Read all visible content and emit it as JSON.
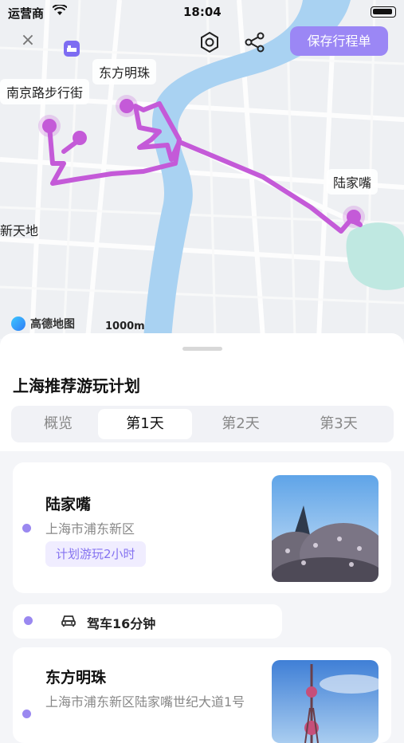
{
  "status_bar": {
    "carrier": "运营商",
    "time": "18:04"
  },
  "header": {
    "save_label": "保存行程单",
    "icons": [
      "close-icon",
      "hotel-icon",
      "settings-icon",
      "share-icon"
    ]
  },
  "map": {
    "labels": {
      "nanjing_road": "南京路步行街",
      "oriental_pearl": "东方明珠",
      "lujiazui": "陆家嘴",
      "xintiandi": "新天地"
    },
    "provider": "高德地图",
    "scale": "1000m",
    "route_color": "#c45ad8",
    "water_color": "#a9d2f2",
    "park_color": "#bfe8e1"
  },
  "plan": {
    "title": "上海推荐游玩计划",
    "tabs": [
      "概览",
      "第1天",
      "第2天",
      "第3天"
    ],
    "active_tab": 1
  },
  "itinerary": {
    "spots": [
      {
        "name": "陆家嘴",
        "address": "上海市浦东新区",
        "duration": "计划游玩2小时"
      },
      {
        "name": "东方明珠",
        "address": "上海市浦东新区陆家嘴世纪大道1号"
      }
    ],
    "transits": [
      {
        "mode": "car-icon",
        "text": "驾车16分钟"
      }
    ]
  },
  "accent_color": "#9b87f5"
}
